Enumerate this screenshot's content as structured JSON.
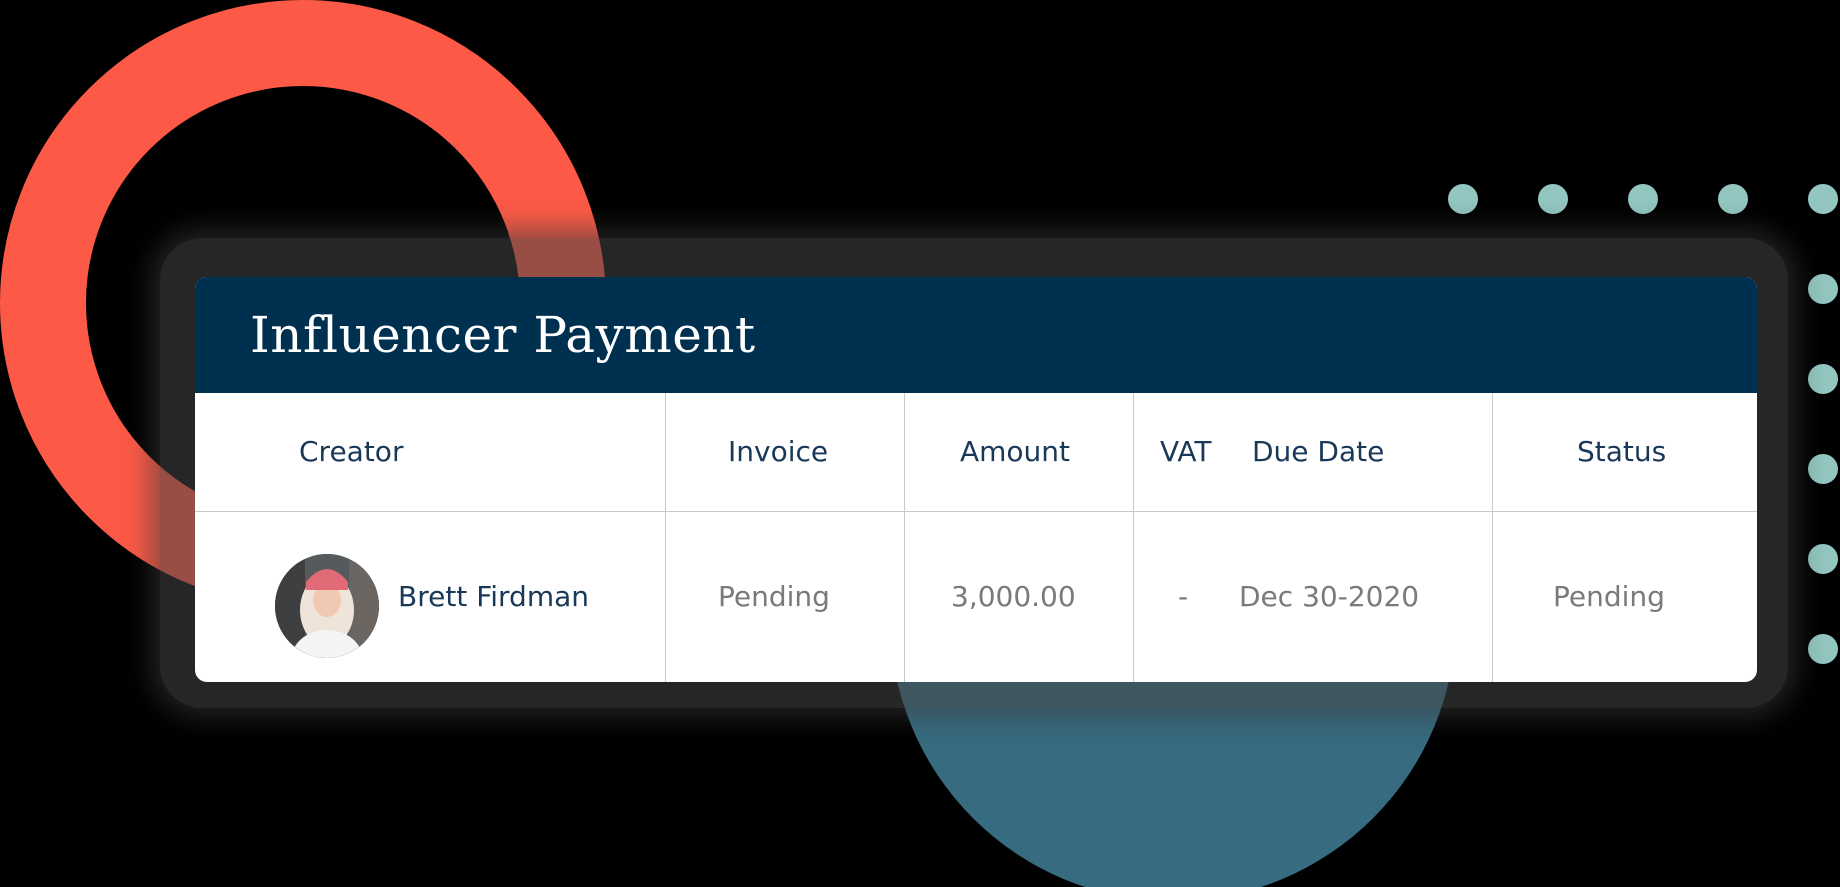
{
  "card": {
    "title": "Influencer Payment"
  },
  "table": {
    "columns": [
      "Creator",
      "Invoice",
      "Amount",
      "VAT",
      "Due Date",
      "Status"
    ],
    "rows": [
      {
        "creator": "Brett Firdman",
        "invoice": "Pending",
        "amount": "3,000.00",
        "vat": "-",
        "due_date": "Dec 30-2020",
        "status": "Pending"
      }
    ]
  },
  "colors": {
    "header_bg": "#00304f",
    "ring": "#fc5a46",
    "teal_circle": "#366b80",
    "dots": "#93c6c0",
    "heading_text": "#1a3958",
    "cell_text": "#7a7a7a"
  }
}
